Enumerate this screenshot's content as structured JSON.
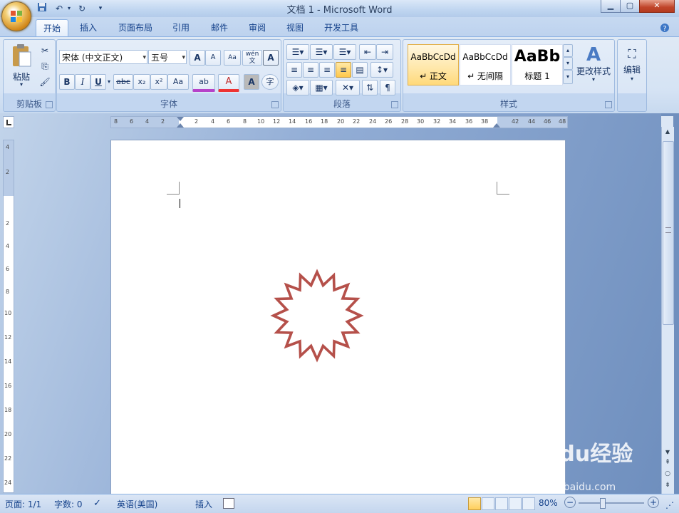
{
  "window": {
    "title": "文档 1 - Microsoft Word"
  },
  "qat": {
    "save_icon": "save-icon",
    "undo_icon": "undo-icon",
    "redo_icon": "redo-icon"
  },
  "tabs": [
    "开始",
    "插入",
    "页面布局",
    "引用",
    "邮件",
    "审阅",
    "视图",
    "开发工具"
  ],
  "active_tab": "开始",
  "ribbon": {
    "clipboard": {
      "paste_label": "粘贴",
      "group_label": "剪贴板"
    },
    "font": {
      "font_name": "宋体 (中文正文)",
      "font_size": "五号",
      "group_label": "字体",
      "bold": "B",
      "italic": "I",
      "underline": "U",
      "strike": "abc",
      "subscript": "x₂",
      "superscript": "x²",
      "change_case": "Aa",
      "grow": "A",
      "shrink": "A",
      "font_color": "A",
      "char_shading": "A",
      "enclose": "字",
      "highlight": "ab",
      "phonetic": "wén 文"
    },
    "paragraph": {
      "group_label": "段落"
    },
    "styles": {
      "group_label": "样式",
      "items": [
        {
          "sample": "AaBbCcDd",
          "name": "↵ 正文"
        },
        {
          "sample": "AaBbCcDd",
          "name": "↵ 无间隔"
        },
        {
          "sample": "AaBb",
          "name": "标题 1"
        }
      ],
      "change_styles": "更改样式"
    },
    "editing": {
      "label": "编辑"
    }
  },
  "ruler": {
    "h_ticks": [
      "8",
      "6",
      "4",
      "2",
      "2",
      "4",
      "6",
      "8",
      "10",
      "12",
      "14",
      "16",
      "18",
      "20",
      "22",
      "24",
      "26",
      "28",
      "30",
      "32",
      "34",
      "36",
      "38",
      "42",
      "44",
      "46",
      "48"
    ],
    "v_ticks": [
      "4",
      "2",
      "2",
      "4",
      "6",
      "8",
      "10",
      "12",
      "14",
      "16",
      "18",
      "20",
      "22",
      "24"
    ]
  },
  "status": {
    "page": "页面: 1/1",
    "words": "字数: 0",
    "language": "英语(美国)",
    "mode": "插入",
    "zoom": "80%"
  },
  "watermark": {
    "logo": "Baidu经验",
    "url": "jingyan.baidu.com"
  },
  "colors": {
    "star_stroke": "#b5504a",
    "accent": "#15428b"
  }
}
